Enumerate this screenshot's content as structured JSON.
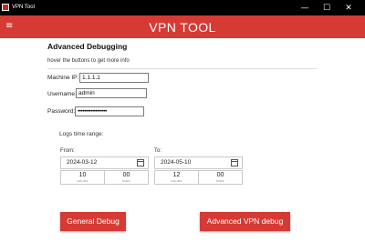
{
  "window": {
    "title": "VPN Tool",
    "minimize_glyph": "—",
    "maximize_glyph": "☐",
    "close_glyph": "✕"
  },
  "header": {
    "title": "VPN TOOL",
    "menu_glyph": "≡",
    "accent_color": "#d63a34"
  },
  "section": {
    "title": "Advanced Debugging",
    "hint": "hover the buttons to get more info"
  },
  "form": {
    "machine_ip_label": "Machine IP:",
    "machine_ip_value": "1.1.1.1",
    "username_label": "Username:",
    "username_value": "admin",
    "password_label": "Password:",
    "password_value": "••••••••••••••••••"
  },
  "logs": {
    "label": "Logs time range:",
    "from_label": "From:",
    "to_label": "To:",
    "from_date": "2024-03-12",
    "to_date": "2024-05-10",
    "from_hours": "10",
    "from_mins": "00",
    "to_hours": "12",
    "to_mins": "00",
    "hours_unit": "HOURS",
    "mins_unit": "MINS"
  },
  "buttons": {
    "general_debug": "General Debug",
    "advanced_vpn_debug": "Advanced VPN debug"
  }
}
